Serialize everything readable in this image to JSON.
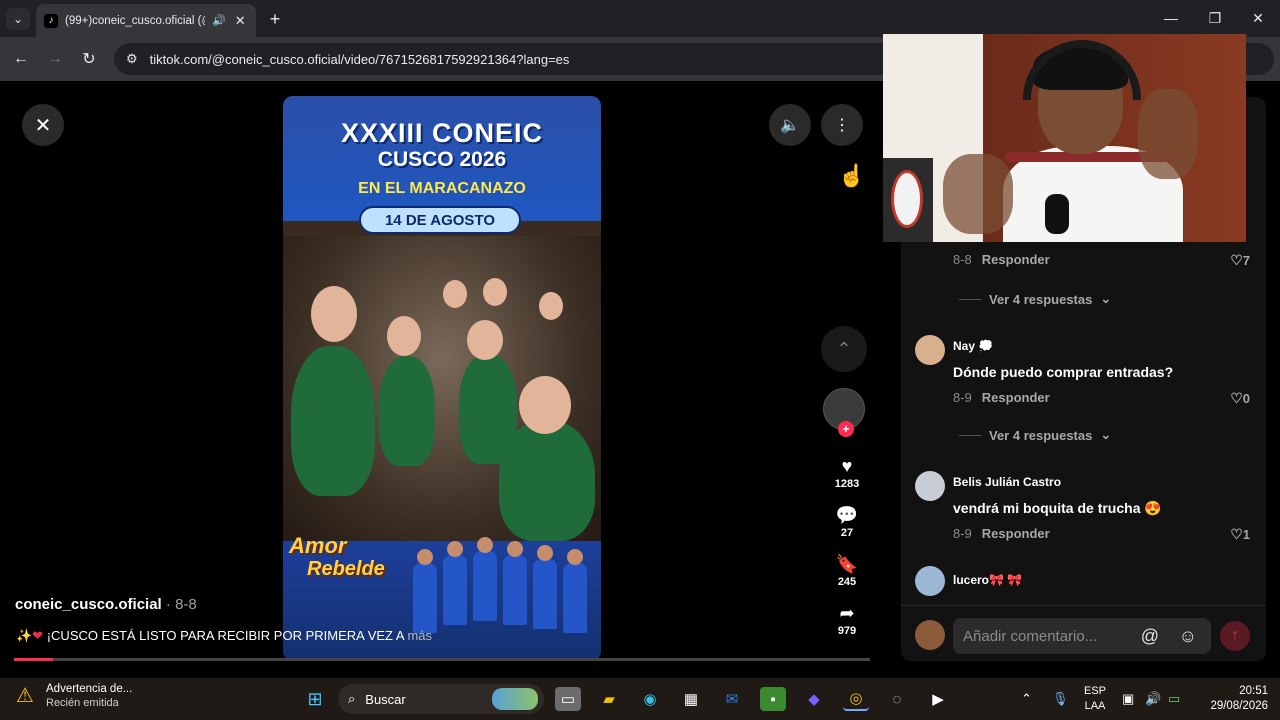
{
  "browser": {
    "tab_title": "(99+)coneic_cusco.oficial (@",
    "url": "tiktok.com/@coneic_cusco.oficial/video/7671526817592921364?lang=es"
  },
  "video": {
    "overlay_line1": "XXXIII CONEIC",
    "overlay_line2": "CUSCO 2026",
    "overlay_line3": "EN EL MARACANAZO",
    "overlay_date": "14 DE AGOSTO",
    "band_line1": "Amor",
    "band_line2": "Rebelde",
    "author": "coneic_cusco.oficial",
    "post_date": " · 8-8",
    "caption": "¡CUSCO ESTÁ LISTO PARA RECIBIR POR PRIMERA VEZ A",
    "caption_emoji": "✨❤",
    "more_label": "más",
    "progress_fraction": 0.045
  },
  "actions": {
    "likes": "1283",
    "comments": "27",
    "saves": "245",
    "shares": "979"
  },
  "comments": {
    "items": [
      {
        "date": "8-8",
        "reply": "Responder",
        "likes": "7"
      },
      {
        "view_replies": "Ver 4 respuestas"
      },
      {
        "name": "Nay 💭",
        "text": "Dónde puedo comprar entradas?",
        "date": "8-9",
        "reply": "Responder",
        "likes": "0"
      },
      {
        "view_replies": "Ver 4 respuestas"
      },
      {
        "name": "Belis Julián Castro",
        "text": "vendrá mi boquita de trucha 😍",
        "date": "8-9",
        "reply": "Responder",
        "likes": "1"
      },
      {
        "name": "lucero🎀 🎀"
      }
    ],
    "input_placeholder": "Añadir comentario..."
  },
  "taskbar": {
    "weather_title": "Advertencia de...",
    "weather_sub": "Recién emitida",
    "search_label": "Buscar",
    "lang_line1": "ESP",
    "lang_line2": "LAA",
    "time": "20:51",
    "date": "29/08/2026"
  },
  "colors": {
    "accent": "#fe2c55",
    "browser_bg": "#202124",
    "toolbar_bg": "#35363a"
  }
}
